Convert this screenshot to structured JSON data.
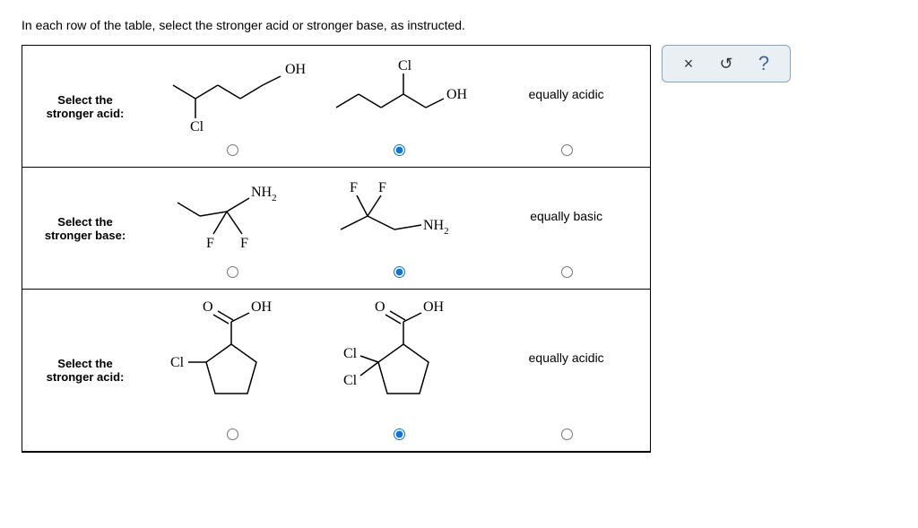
{
  "instruction": "In each row of the table, select the stronger acid or stronger base, as instructed.",
  "rows": [
    {
      "label": "Select the\nstronger acid:",
      "eq": "equally acidic"
    },
    {
      "label": "Select the\nstronger base:",
      "eq": "equally basic"
    },
    {
      "label": "Select the\nstronger acid:",
      "eq": "equally acidic"
    }
  ],
  "molecules": {
    "r1a": {
      "oh": "OH",
      "cl": "Cl"
    },
    "r1b": {
      "oh": "OH",
      "cl": "Cl"
    },
    "r2a": {
      "nh2": "NH",
      "sub": "2",
      "f1": "F",
      "f2": "F"
    },
    "r2b": {
      "nh2": "NH",
      "sub": "2",
      "f1": "F",
      "f2": "F"
    },
    "r3a": {
      "o": "O",
      "oh": "OH",
      "cl": "Cl"
    },
    "r3b": {
      "o": "O",
      "oh": "OH",
      "cl1": "Cl",
      "cl2": "Cl"
    }
  },
  "toolbar": {
    "close": "×",
    "reset": "↺",
    "help": "?"
  }
}
